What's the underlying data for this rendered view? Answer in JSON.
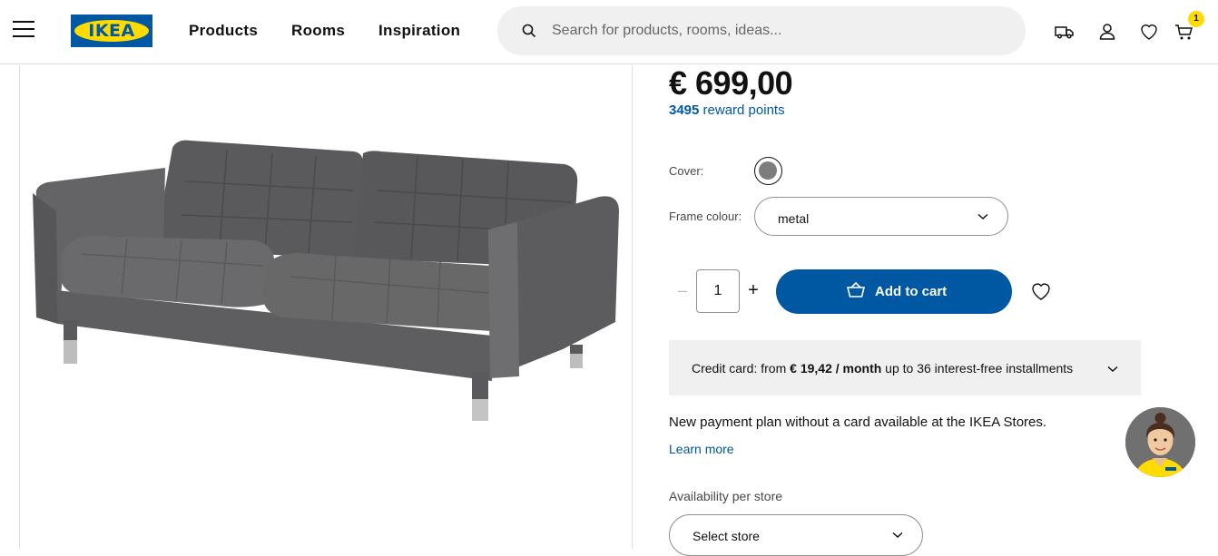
{
  "header": {
    "logo_text": "IKEA",
    "nav": [
      "Products",
      "Rooms",
      "Inspiration"
    ],
    "search_placeholder": "Search for products, rooms, ideas...",
    "cart_count": "1",
    "colors": {
      "brand_blue": "#0058a3",
      "brand_yellow": "#ffdb00"
    }
  },
  "product": {
    "price": "€ 699,00",
    "reward_points": "3495",
    "reward_label": " reward points",
    "cover_label": "Cover:",
    "cover_swatch_color": "#7d7d7d",
    "frame_label": "Frame colour:",
    "frame_value": "metal",
    "quantity": "1",
    "minus": "–",
    "plus": "+",
    "add_to_cart": "Add to cart"
  },
  "credit": {
    "prefix": "Credit card: from ",
    "amount": "€ 19,42 / month",
    "suffix": " up to 36 interest-free installments"
  },
  "payment": {
    "new_plan": "New payment plan without a card available at the IKEA Stores.",
    "learn_more": "Learn more"
  },
  "availability": {
    "label": "Availability per store",
    "select_placeholder": "Select store"
  },
  "icons": [
    "hamburger-icon",
    "search-icon",
    "truck-icon",
    "user-icon",
    "heart-icon",
    "cart-icon",
    "chevron-down-icon",
    "basket-icon",
    "assistant-avatar"
  ]
}
